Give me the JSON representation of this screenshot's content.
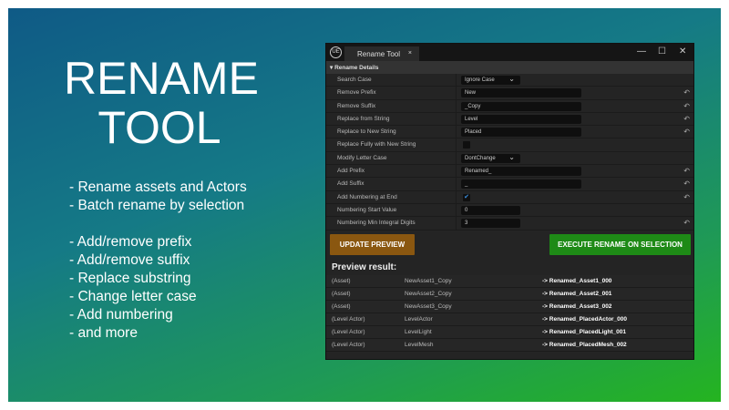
{
  "hero": {
    "title_line1": "RENAME",
    "title_line2": "TOOL",
    "features_a": [
      "- Rename assets and Actors",
      "- Batch rename by selection"
    ],
    "features_b": [
      "- Add/remove prefix",
      "- Add/remove suffix",
      "- Replace substring",
      "- Change letter case",
      "- Add numbering",
      "- and more"
    ]
  },
  "window": {
    "logo": "UE",
    "tab_label": "Rename Tool",
    "tab_close": "×",
    "minimize": "—",
    "maximize": "☐",
    "close": "✕",
    "section": "Rename Details",
    "rows": [
      {
        "label": "Search Case",
        "type": "dropdown",
        "value": "Ignore Case",
        "reset": false
      },
      {
        "label": "Remove Prefix",
        "type": "text",
        "value": "New",
        "reset": true
      },
      {
        "label": "Remove Suffix",
        "type": "text",
        "value": "_Copy",
        "reset": true
      },
      {
        "label": "Replace from String",
        "type": "text",
        "value": "Level",
        "reset": true
      },
      {
        "label": "Replace to New String",
        "type": "text",
        "value": "Placed",
        "reset": true
      },
      {
        "label": "Replace Fully with New String",
        "type": "checkbox",
        "checked": false,
        "reset": false
      },
      {
        "label": "Modify Letter Case",
        "type": "dropdown",
        "value": "DontChange",
        "reset": false
      },
      {
        "label": "Add Prefix",
        "type": "text",
        "value": "Renamed_",
        "reset": true
      },
      {
        "label": "Add Suffix",
        "type": "text",
        "value": "_",
        "reset": true
      },
      {
        "label": "Add Numbering at End",
        "type": "checkbox",
        "checked": true,
        "reset": true
      },
      {
        "label": "Numbering Start Value",
        "type": "number",
        "value": "0",
        "reset": false
      },
      {
        "label": "Numbering Min Integral Digits",
        "type": "number",
        "value": "3",
        "reset": true
      }
    ],
    "update_button": "UPDATE PREVIEW",
    "execute_button": "EXECUTE RENAME ON SELECTION",
    "preview_label": "Preview result:",
    "preview": [
      {
        "type": "(Asset)",
        "name": "NewAsset1_Copy",
        "result": "-> Renamed_Asset1_000"
      },
      {
        "type": "(Asset)",
        "name": "NewAsset2_Copy",
        "result": "-> Renamed_Asset2_001"
      },
      {
        "type": "(Asset)",
        "name": "NewAsset3_Copy",
        "result": "-> Renamed_Asset3_002"
      },
      {
        "type": "(Level Actor)",
        "name": "LevelActor",
        "result": "-> Renamed_PlacedActor_000"
      },
      {
        "type": "(Level Actor)",
        "name": "LevelLight",
        "result": "-> Renamed_PlacedLight_001"
      },
      {
        "type": "(Level Actor)",
        "name": "LevelMesh",
        "result": "-> Renamed_PlacedMesh_002"
      }
    ]
  },
  "colors": {
    "update": "#8a5710",
    "execute": "#1e8a16"
  }
}
